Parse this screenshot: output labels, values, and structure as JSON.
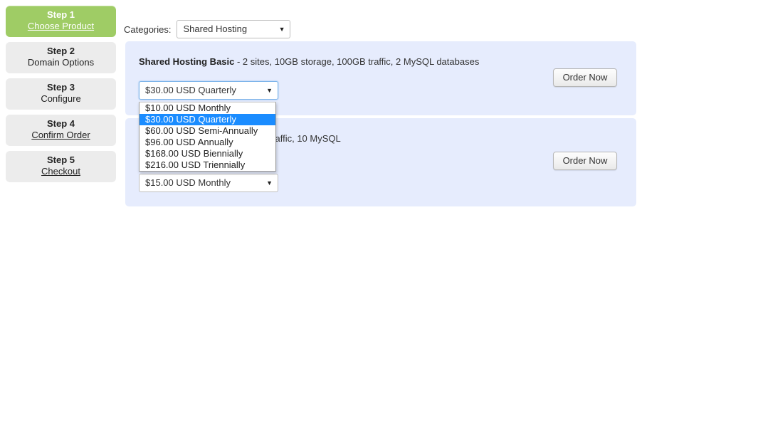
{
  "steps": [
    {
      "num": "Step 1",
      "label": "Choose Product",
      "active": true,
      "link": true
    },
    {
      "num": "Step 2",
      "label": "Domain Options",
      "active": false,
      "link": false
    },
    {
      "num": "Step 3",
      "label": "Configure",
      "active": false,
      "link": false
    },
    {
      "num": "Step 4",
      "label": "Confirm Order",
      "active": false,
      "link": true
    },
    {
      "num": "Step 5",
      "label": "Checkout",
      "active": false,
      "link": true
    }
  ],
  "categories": {
    "label": "Categories:",
    "selected": "Shared Hosting",
    "caret": "▼",
    "options": [
      "Shared Hosting"
    ]
  },
  "products": [
    {
      "name": "Shared Hosting Basic",
      "description": " - 2 sites, 10GB storage, 100GB traffic, 2 MySQL databases",
      "order_label": "Order Now",
      "cycle_selected": "$30.00 USD Quarterly",
      "caret": "▼"
    },
    {
      "name": "",
      "description": "10 sites, 25GB storage, 250GB traffic, 10 MySQL",
      "order_label": "Order Now",
      "cycle_selected": "$15.00 USD Monthly",
      "caret": "▼"
    }
  ],
  "dropdown": {
    "open_for_product_index": 0,
    "selected_value": "$30.00 USD Quarterly",
    "options": [
      "$10.00 USD Monthly",
      "$30.00 USD Quarterly",
      "$60.00 USD Semi-Annually",
      "$96.00 USD Annually",
      "$168.00 USD Biennially",
      "$216.00 USD Triennially"
    ]
  },
  "colors": {
    "active_step": "#9fcc65",
    "step_bg": "#ececec",
    "panel_bg": "#e6ecfd",
    "option_highlight": "#1a8cff",
    "focus_border": "#7eb4ea"
  }
}
